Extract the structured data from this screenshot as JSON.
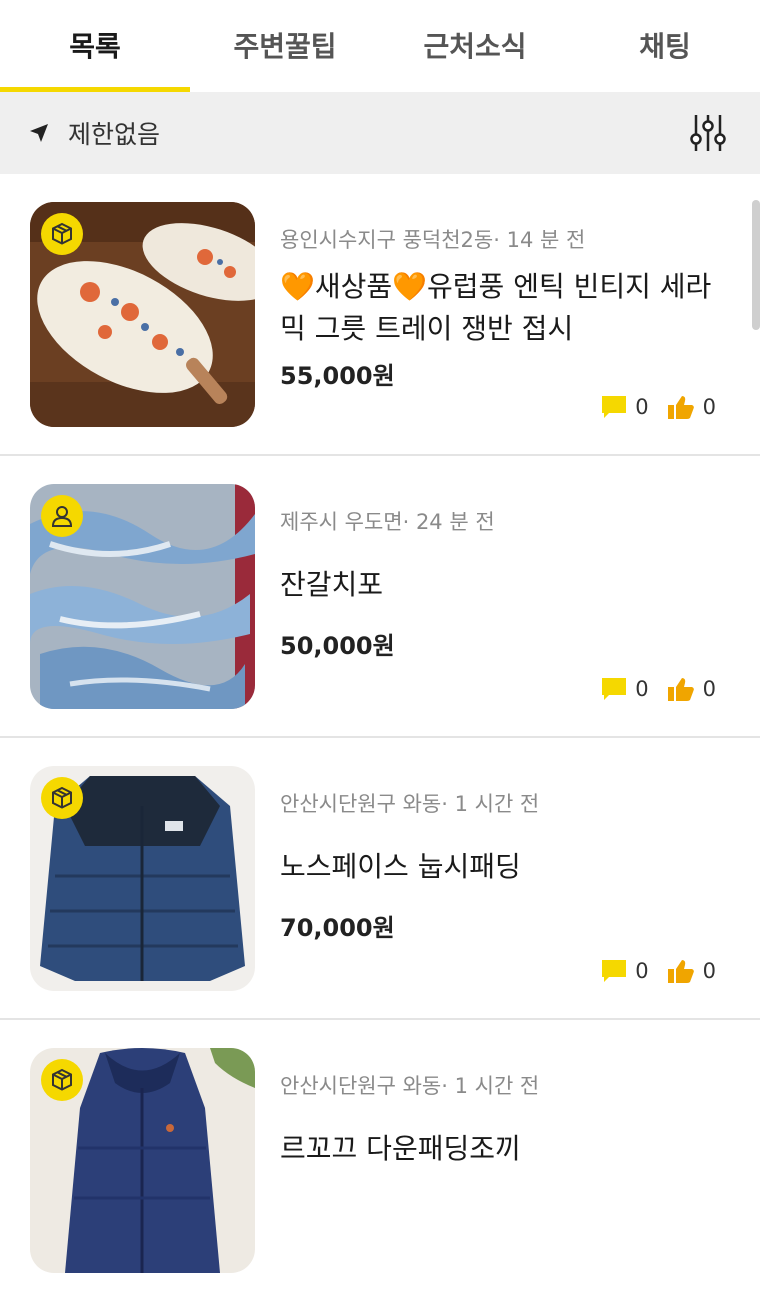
{
  "tabs": [
    {
      "label": "목록",
      "active": true
    },
    {
      "label": "주변꿀팁",
      "active": false
    },
    {
      "label": "근처소식",
      "active": false
    },
    {
      "label": "채팅",
      "active": false
    }
  ],
  "location": {
    "icon": "navigation-arrow-icon",
    "label": "제한없음",
    "filter_icon": "filter-sliders-icon"
  },
  "accent_color": "#f5d800",
  "items": [
    {
      "meta": "용인시수지구 풍덕천2동· 14 분 전",
      "title": "🧡새상품🧡유럽풍 엔틱 빈티지 세라믹 그릇 트레이 쟁반 접시",
      "price": "55,000원",
      "badge_icon": "package-icon",
      "comments": "0",
      "likes": "0"
    },
    {
      "meta": "제주시 우도면· 24 분 전",
      "title": "잔갈치포",
      "price": "50,000원",
      "badge_icon": "user-icon",
      "comments": "0",
      "likes": "0"
    },
    {
      "meta": "안산시단원구 와동· 1 시간 전",
      "title": "노스페이스 눕시패딩",
      "price": "70,000원",
      "badge_icon": "package-icon",
      "comments": "0",
      "likes": "0"
    },
    {
      "meta": "안산시단원구 와동· 1 시간 전",
      "title": "르꼬끄 다운패딩조끼",
      "price": "",
      "badge_icon": "package-icon",
      "comments": "",
      "likes": ""
    }
  ]
}
